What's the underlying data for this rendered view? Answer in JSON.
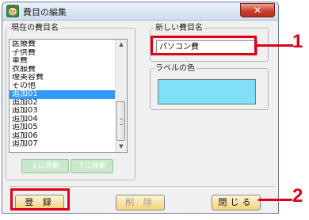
{
  "window": {
    "title": "費目の編集",
    "close_label": "✕"
  },
  "list_group": {
    "label": "現在の費目名",
    "items": [
      "医療費",
      "子供費",
      "車費",
      "衣服費",
      "理美容費",
      "その他",
      "追加01",
      "追加02",
      "追加03",
      "追加04",
      "追加05",
      "追加06",
      "追加07"
    ],
    "selected_index": 6,
    "move_up_label": "上に移動",
    "move_down_label": "下に移動"
  },
  "name_group": {
    "label": "新しい費目名",
    "value": "パソコン費"
  },
  "color_group": {
    "label": "ラベルの色",
    "color": "#80e0f8"
  },
  "buttons": {
    "register": "登 録",
    "delete": "削 除",
    "close": "閉じる"
  },
  "callouts": {
    "one": "1",
    "two": "2"
  },
  "colors": {
    "accent": "#e0001a",
    "selection": "#3399ff"
  }
}
